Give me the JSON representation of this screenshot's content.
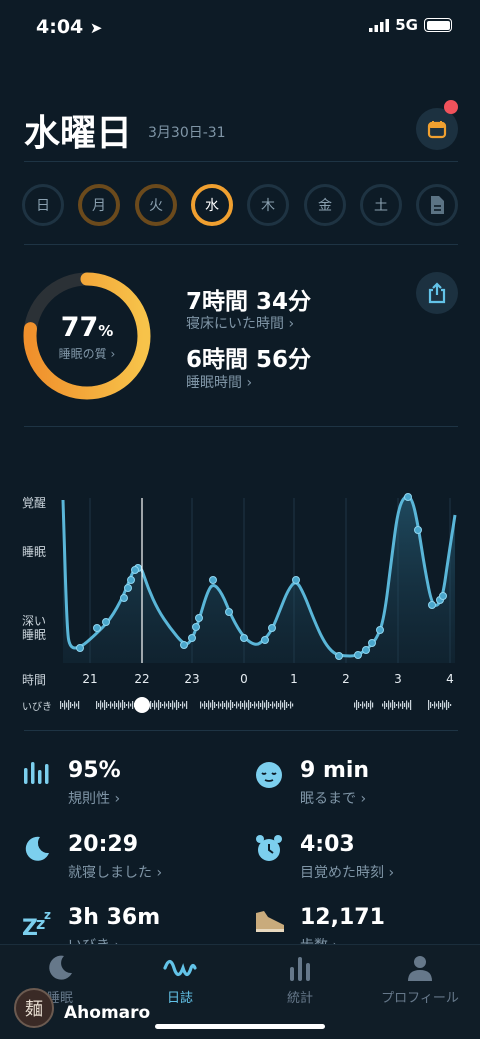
{
  "status": {
    "time": "4:04",
    "network": "5G"
  },
  "header": {
    "title": "水曜日",
    "date_range": "3月30日-31"
  },
  "days": [
    {
      "label": "日",
      "state": "empty"
    },
    {
      "label": "月",
      "state": "partial"
    },
    {
      "label": "火",
      "state": "partial"
    },
    {
      "label": "水",
      "state": "selected"
    },
    {
      "label": "木",
      "state": "empty"
    },
    {
      "label": "金",
      "state": "empty"
    },
    {
      "label": "土",
      "state": "empty"
    }
  ],
  "summary": {
    "quality_value": "77",
    "quality_unit": "%",
    "quality_label": "睡眠の質",
    "in_bed_value": "7時間 34分",
    "in_bed_label": "寝床にいた時間",
    "asleep_value": "6時間 56分",
    "asleep_label": "睡眠時間"
  },
  "chart": {
    "y_labels": [
      "覚醒",
      "睡眠",
      "深い",
      "睡眠"
    ],
    "x_axis_title": "時間",
    "snore_label": "いびき",
    "x_ticks": [
      "21",
      "22",
      "23",
      "0",
      "1",
      "2",
      "3",
      "4"
    ]
  },
  "chart_data": {
    "type": "area",
    "x_ticks": [
      "21",
      "22",
      "23",
      "0",
      "1",
      "2",
      "3",
      "4"
    ],
    "y_categories": [
      "深い睡眠",
      "睡眠",
      "覚醒"
    ],
    "quality_percent": 77
  },
  "stats": [
    {
      "value": "95%",
      "label": "規則性",
      "icon": "regularity-icon"
    },
    {
      "value": "9 min",
      "label": "眠るまで",
      "icon": "sleepy-face-icon"
    },
    {
      "value": "20:29",
      "label": "就寝しました",
      "icon": "moon-icon"
    },
    {
      "value": "4:03",
      "label": "目覚めた時刻",
      "icon": "alarm-clock-icon"
    },
    {
      "value": "3h 36m",
      "label": "いびき",
      "icon": "snore-zzz-icon"
    },
    {
      "value": "12,171",
      "label": "歩数",
      "icon": "shoe-icon"
    }
  ],
  "tabs": [
    {
      "label": "睡眠",
      "icon": "moon-icon"
    },
    {
      "label": "日誌",
      "icon": "wave-icon",
      "active": true
    },
    {
      "label": "統計",
      "icon": "bars-icon"
    },
    {
      "label": "プロフィール",
      "icon": "person-icon"
    }
  ],
  "watermark": {
    "text": "Ahomaro"
  },
  "colors": {
    "accent": "#f0a030",
    "line": "#5ab6d8",
    "background": "#0d1b26"
  }
}
